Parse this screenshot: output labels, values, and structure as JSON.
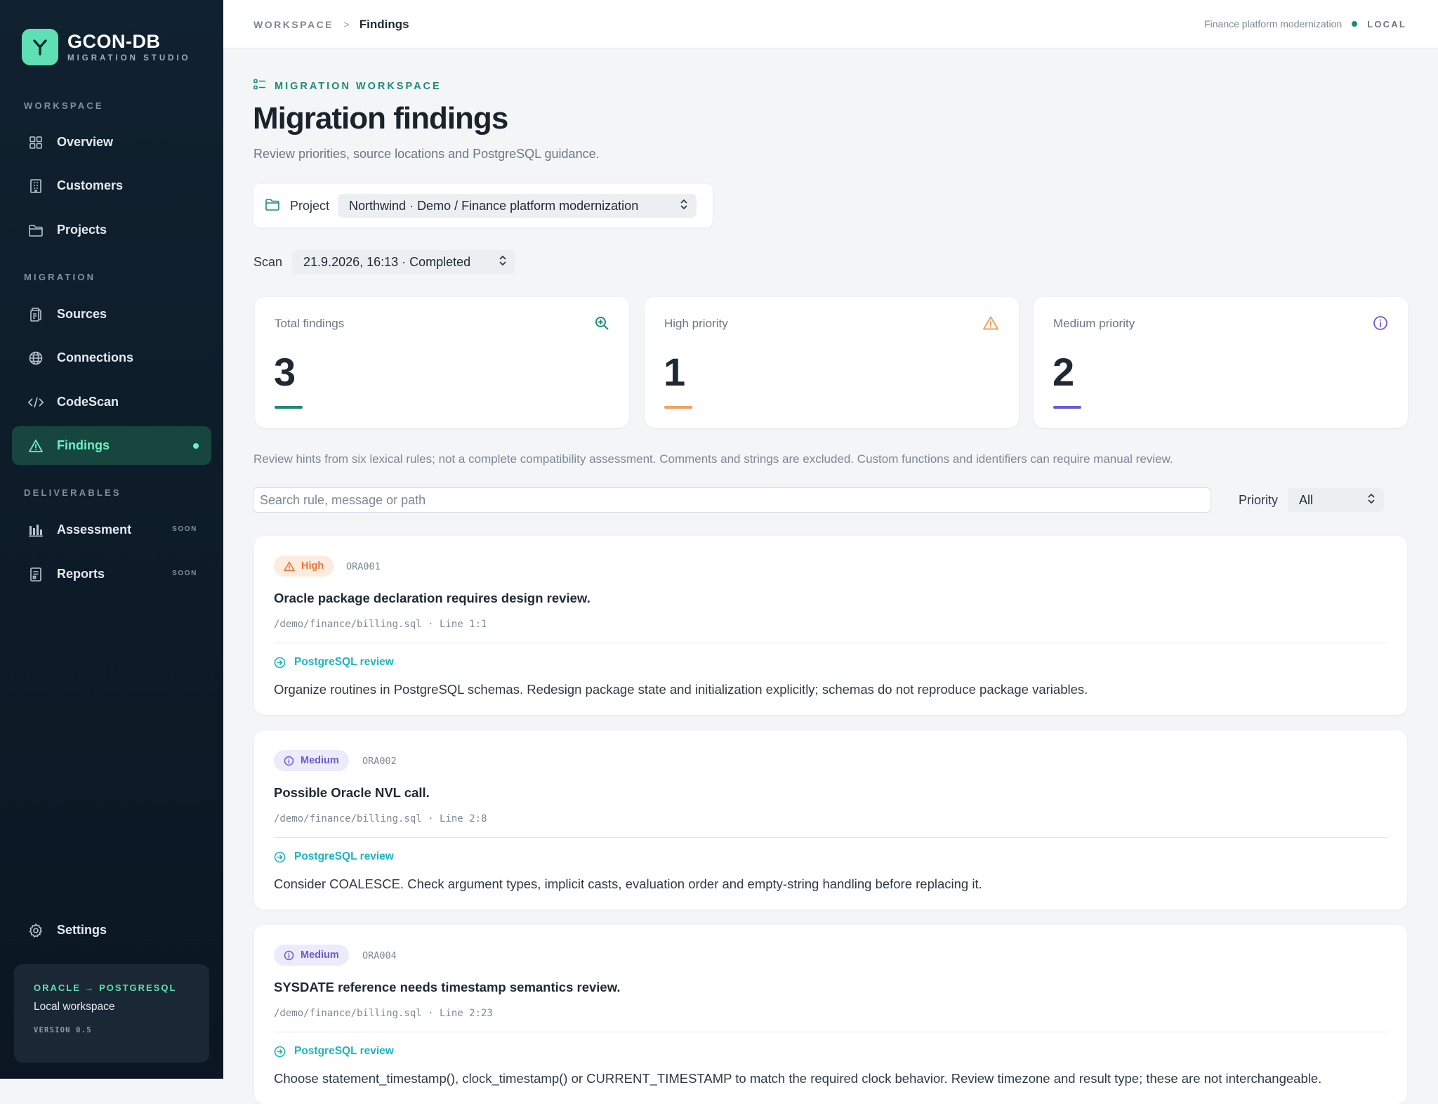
{
  "brand": {
    "name": "GCON-DB",
    "subtitle": "MIGRATION STUDIO"
  },
  "sidebar": {
    "sections": [
      {
        "title": "WORKSPACE"
      },
      {
        "title": "MIGRATION"
      },
      {
        "title": "DELIVERABLES"
      }
    ],
    "items": [
      {
        "label": "Overview",
        "icon": "grid-icon"
      },
      {
        "label": "Customers",
        "icon": "building-icon"
      },
      {
        "label": "Projects",
        "icon": "folder-icon"
      },
      {
        "label": "Sources",
        "icon": "files-icon"
      },
      {
        "label": "Connections",
        "icon": "globe-icon"
      },
      {
        "label": "CodeScan",
        "icon": "code-icon"
      },
      {
        "label": "Findings",
        "icon": "warning-icon",
        "active": true
      },
      {
        "label": "Assessment",
        "icon": "bar-chart-icon",
        "badge": "SOON"
      },
      {
        "label": "Reports",
        "icon": "report-icon",
        "badge": "SOON"
      },
      {
        "label": "Settings",
        "icon": "gear-icon"
      }
    ],
    "footer": {
      "title": "ORACLE → POSTGRESQL",
      "subtitle": "Local workspace",
      "version": "VERSION 0.5"
    }
  },
  "topbar": {
    "breadcrumb_root": "WORKSPACE",
    "breadcrumb_sep": ">",
    "breadcrumb_current": "Findings",
    "project_name": "Finance platform modernization",
    "mode": "LOCAL"
  },
  "header": {
    "eyebrow": "MIGRATION WORKSPACE",
    "title": "Migration findings",
    "subtitle": "Review priorities, source locations and PostgreSQL guidance."
  },
  "filters": {
    "project_label": "Project",
    "project_value": "Northwind · Demo / Finance platform modernization",
    "scan_label": "Scan",
    "scan_value": "21.9.2026, 16:13 · Completed",
    "search_placeholder": "Search rule, message or path",
    "priority_label": "Priority",
    "priority_value": "All"
  },
  "stats": [
    {
      "label": "Total findings",
      "value": "3",
      "color": "#1f8b73",
      "icon": "search-icon"
    },
    {
      "label": "High priority",
      "value": "1",
      "color": "#f0a25c",
      "icon": "warning-icon"
    },
    {
      "label": "Medium priority",
      "value": "2",
      "color": "#6c5ad6",
      "icon": "info-icon"
    }
  ],
  "hint": "Review hints from six lexical rules; not a complete compatibility assessment. Comments and strings are excluded. Custom functions and identifiers can require manual review.",
  "findings": [
    {
      "priority": "High",
      "rule": "ORA001",
      "title": "Oracle package declaration requires design review.",
      "location": "/demo/finance/billing.sql · Line 1:1",
      "review_label": "PostgreSQL review",
      "guidance": "Organize routines in PostgreSQL schemas. Redesign package state and initialization explicitly; schemas do not reproduce package variables."
    },
    {
      "priority": "Medium",
      "rule": "ORA002",
      "title": "Possible Oracle NVL call.",
      "location": "/demo/finance/billing.sql · Line 2:8",
      "review_label": "PostgreSQL review",
      "guidance": "Consider COALESCE. Check argument types, implicit casts, evaluation order and empty-string handling before replacing it."
    },
    {
      "priority": "Medium",
      "rule": "ORA004",
      "title": "SYSDATE reference needs timestamp semantics review.",
      "location": "/demo/finance/billing.sql · Line 2:23",
      "review_label": "PostgreSQL review",
      "guidance": "Choose statement_timestamp(), clock_timestamp() or CURRENT_TIMESTAMP to match the required clock behavior. Review timezone and result type; these are not interchangeable."
    }
  ]
}
